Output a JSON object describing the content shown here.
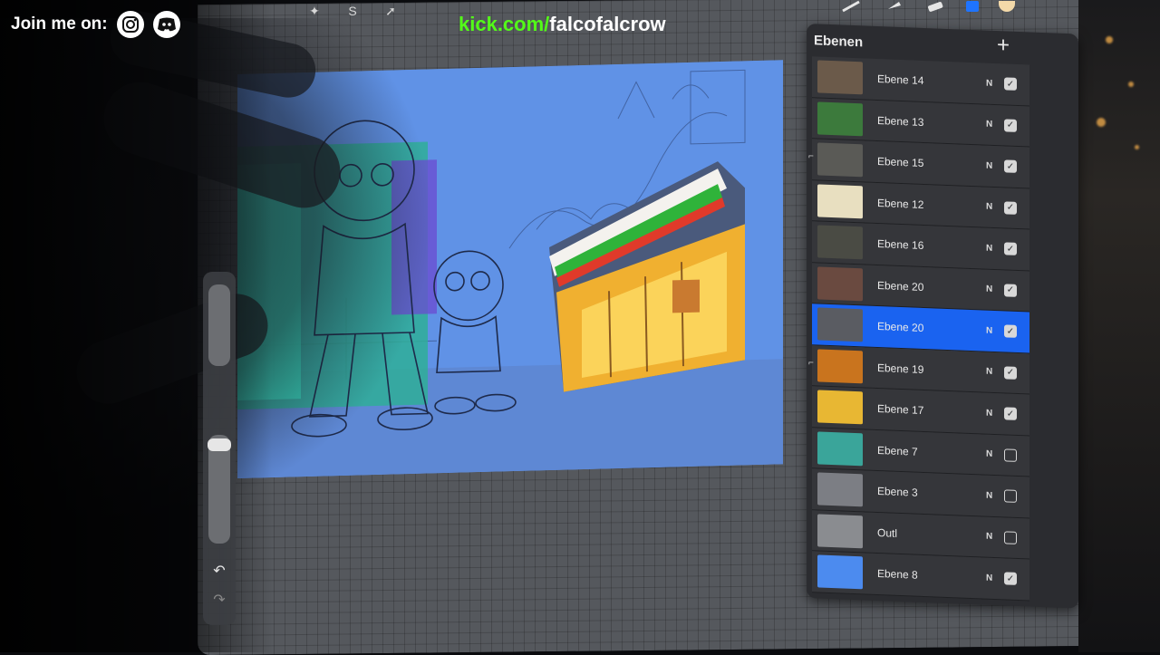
{
  "overlay": {
    "social_label": "Join me on:",
    "social_icons": [
      "instagram-icon",
      "discord-icon"
    ],
    "kick_domain": "kick.com/",
    "kick_channel": "falcofalcrow"
  },
  "toolbar": {
    "top_tools": [
      "wand-icon",
      "selection-s-icon",
      "arrow-icon"
    ],
    "right_tools": [
      "brush-icon",
      "smudge-icon",
      "eraser-icon",
      "layers-icon",
      "color-icon"
    ],
    "active_color": "#1f74ff"
  },
  "layers_panel": {
    "title": "Ebenen",
    "add_label": "+",
    "layers": [
      {
        "name": "Ebene 14",
        "blend": "N",
        "visible": true,
        "active": false,
        "clipped": false,
        "thumb": "#6b5a4a"
      },
      {
        "name": "Ebene 13",
        "blend": "N",
        "visible": true,
        "active": false,
        "clipped": false,
        "thumb": "#3c7a3c"
      },
      {
        "name": "Ebene 15",
        "blend": "N",
        "visible": true,
        "active": false,
        "clipped": true,
        "thumb": "#5a5a56"
      },
      {
        "name": "Ebene 12",
        "blend": "N",
        "visible": true,
        "active": false,
        "clipped": false,
        "thumb": "#e8dfc0"
      },
      {
        "name": "Ebene 16",
        "blend": "N",
        "visible": true,
        "active": false,
        "clipped": false,
        "thumb": "#4a4b44"
      },
      {
        "name": "Ebene 20",
        "blend": "N",
        "visible": true,
        "active": false,
        "clipped": false,
        "thumb": "#6a4a40"
      },
      {
        "name": "Ebene 20",
        "blend": "N",
        "visible": true,
        "active": true,
        "clipped": false,
        "thumb": "#5a5c62"
      },
      {
        "name": "Ebene 19",
        "blend": "N",
        "visible": true,
        "active": false,
        "clipped": true,
        "thumb": "#c9741e"
      },
      {
        "name": "Ebene 17",
        "blend": "N",
        "visible": true,
        "active": false,
        "clipped": false,
        "thumb": "#e8b733"
      },
      {
        "name": "Ebene 7",
        "blend": "N",
        "visible": false,
        "active": false,
        "clipped": false,
        "thumb": "#3aa59a"
      },
      {
        "name": "Ebene 3",
        "blend": "N",
        "visible": false,
        "active": false,
        "clipped": false,
        "thumb": "#7c7e84"
      },
      {
        "name": "Outl",
        "blend": "N",
        "visible": false,
        "active": false,
        "clipped": false,
        "thumb": "#8a8c90"
      },
      {
        "name": "Ebene 8",
        "blend": "N",
        "visible": true,
        "active": false,
        "clipped": false,
        "thumb": "#4c8bef"
      }
    ]
  },
  "sidebar": {
    "undo_icon": "undo-icon",
    "redo_icon": "redo-icon"
  }
}
